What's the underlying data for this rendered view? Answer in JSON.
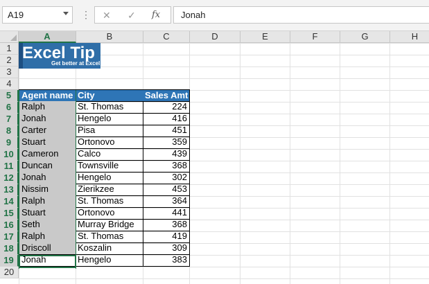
{
  "formula_bar": {
    "name_box": "A19",
    "cancel_glyph": "✕",
    "enter_glyph": "✓",
    "function_glyph": "fx",
    "formula": "Jonah"
  },
  "columns": [
    "A",
    "B",
    "C",
    "D",
    "E",
    "F",
    "G",
    "H"
  ],
  "rows": [
    "1",
    "2",
    "3",
    "4",
    "5",
    "6",
    "7",
    "8",
    "9",
    "10",
    "11",
    "12",
    "13",
    "14",
    "15",
    "16",
    "17",
    "18",
    "19",
    "20"
  ],
  "logo": {
    "title": "Excel Tip",
    "tagline": "Get better at Excel"
  },
  "table": {
    "headers": [
      "Agent name",
      "City",
      "Sales Amt"
    ],
    "rows": [
      [
        "Ralph",
        "St. Thomas",
        "224"
      ],
      [
        "Jonah",
        "Hengelo",
        "416"
      ],
      [
        "Carter",
        "Pisa",
        "451"
      ],
      [
        "Stuart",
        "Ortonovo",
        "359"
      ],
      [
        "Cameron",
        "Calco",
        "439"
      ],
      [
        "Duncan",
        "Townsville",
        "368"
      ],
      [
        "Jonah",
        "Hengelo",
        "302"
      ],
      [
        "Nissim",
        "Zierikzee",
        "453"
      ],
      [
        "Ralph",
        "St. Thomas",
        "364"
      ],
      [
        "Stuart",
        "Ortonovo",
        "441"
      ],
      [
        "Seth",
        "Murray Bridge",
        "368"
      ],
      [
        "Ralph",
        "St. Thomas",
        "419"
      ],
      [
        "Driscoll",
        "Koszalin",
        "309"
      ],
      [
        "Jonah",
        "Hengelo",
        "383"
      ]
    ]
  },
  "colors": {
    "header_fill": "#2e75b6",
    "highlight_fill": "#c9c9c9",
    "selection": "#217346"
  }
}
